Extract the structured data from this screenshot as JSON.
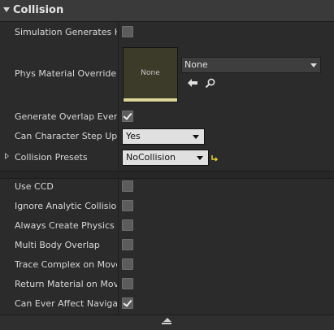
{
  "section": {
    "title": "Collision"
  },
  "rows": {
    "simulation_generates_hit": {
      "label": "Simulation Generates Hit",
      "checked": false
    },
    "phys_material_override": {
      "label": "Phys Material Override",
      "thumbnail_text": "None",
      "value": "None"
    },
    "generate_overlap_events": {
      "label": "Generate Overlap Events",
      "checked": true
    },
    "can_character_step_up": {
      "label": "Can Character Step Up On",
      "value": "Yes"
    },
    "collision_presets": {
      "label": "Collision Presets",
      "value": "NoCollision"
    },
    "use_ccd": {
      "label": "Use CCD",
      "checked": false
    },
    "ignore_analytic_collisions": {
      "label": "Ignore Analytic Collisions",
      "checked": false
    },
    "always_create_physics_state": {
      "label": "Always Create Physics State",
      "checked": false
    },
    "multi_body_overlap": {
      "label": "Multi Body Overlap",
      "checked": false
    },
    "trace_complex_on_move": {
      "label": "Trace Complex on Move",
      "checked": false
    },
    "return_material_on_move": {
      "label": "Return Material on Move",
      "checked": false
    },
    "can_ever_affect_navigation": {
      "label": "Can Ever Affect Navigation",
      "checked": true
    }
  },
  "icons": {
    "section_toggle": "collapse-arrow-icon",
    "use_selected": "use-selected-arrow-icon",
    "browse": "magnifier-icon",
    "reset_default": "reset-to-default-icon",
    "advanced_toggle": "collapse-advanced-icon"
  }
}
